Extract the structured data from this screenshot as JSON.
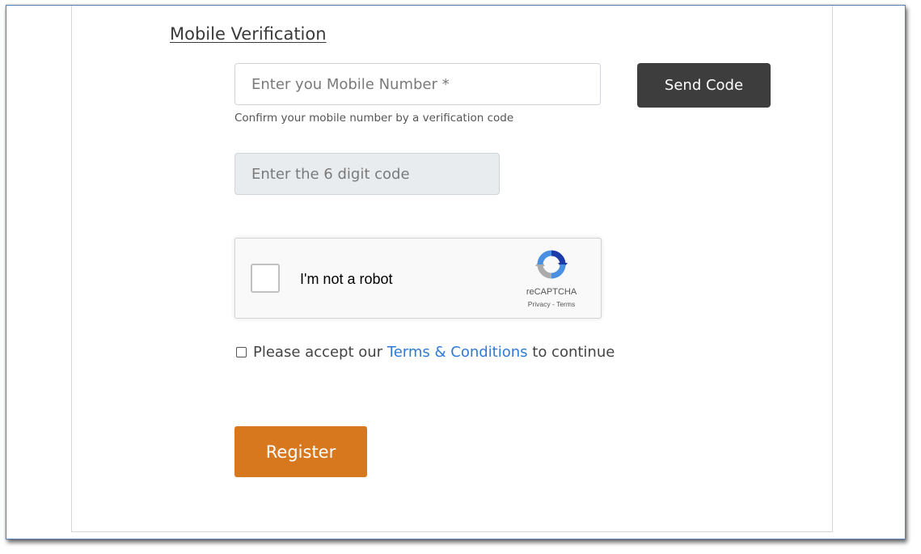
{
  "section": {
    "title": "Mobile Verification"
  },
  "mobile": {
    "placeholder": "Enter you Mobile Number *",
    "value": "",
    "send_code_label": "Send Code",
    "helper": "Confirm your mobile number by a verification code"
  },
  "code": {
    "placeholder": "Enter the 6 digit code",
    "value": ""
  },
  "recaptcha": {
    "label": "I'm not a robot",
    "brand": "reCAPTCHA",
    "links": "Privacy - Terms",
    "logo_icon": "recaptcha-logo-icon"
  },
  "terms": {
    "prefix": "Please accept our ",
    "link": "Terms & Conditions",
    "suffix": " to continue"
  },
  "register": {
    "label": "Register"
  },
  "colors": {
    "accent": "#d7781f",
    "send_button": "#3d3d3d",
    "link": "#2f7ad6"
  }
}
